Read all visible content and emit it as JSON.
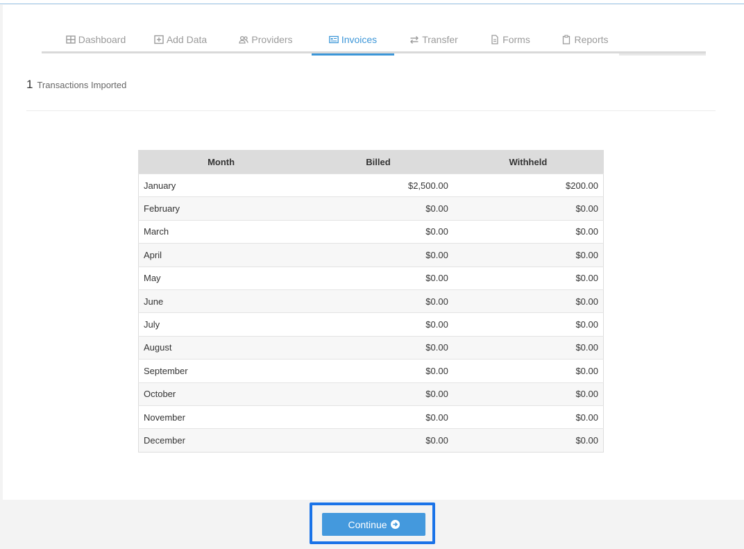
{
  "tabs": [
    {
      "label": "Dashboard",
      "icon": "table-icon"
    },
    {
      "label": "Add Data",
      "icon": "plus-square-icon"
    },
    {
      "label": "Providers",
      "icon": "users-icon"
    },
    {
      "label": "Invoices",
      "icon": "invoice-card-icon",
      "active": true
    },
    {
      "label": "Transfer",
      "icon": "exchange-icon"
    },
    {
      "label": "Forms",
      "icon": "document-icon"
    },
    {
      "label": "Reports",
      "icon": "clipboard-icon"
    }
  ],
  "summary": {
    "count": "1",
    "label": "Transactions Imported"
  },
  "table": {
    "headers": [
      "Month",
      "Billed",
      "Withheld"
    ],
    "rows": [
      [
        "January",
        "$2,500.00",
        "$200.00"
      ],
      [
        "February",
        "$0.00",
        "$0.00"
      ],
      [
        "March",
        "$0.00",
        "$0.00"
      ],
      [
        "April",
        "$0.00",
        "$0.00"
      ],
      [
        "May",
        "$0.00",
        "$0.00"
      ],
      [
        "June",
        "$0.00",
        "$0.00"
      ],
      [
        "July",
        "$0.00",
        "$0.00"
      ],
      [
        "August",
        "$0.00",
        "$0.00"
      ],
      [
        "September",
        "$0.00",
        "$0.00"
      ],
      [
        "October",
        "$0.00",
        "$0.00"
      ],
      [
        "November",
        "$0.00",
        "$0.00"
      ],
      [
        "December",
        "$0.00",
        "$0.00"
      ]
    ]
  },
  "footer": {
    "continue_label": "Continue",
    "continue_icon": "arrow-circle-right-icon"
  },
  "colors": {
    "accent": "#3c96d8",
    "button": "#4499dd",
    "highlight_frame": "#1a73e8"
  }
}
